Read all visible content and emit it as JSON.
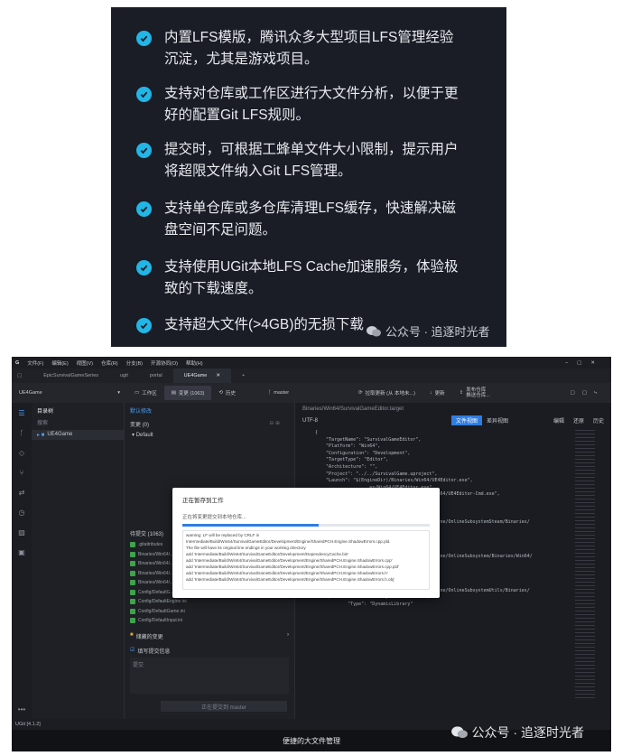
{
  "features": [
    {
      "line1": "内置LFS模版，腾讯众多大型项目LFS管理经验",
      "line2": "沉淀，尤其是游戏项目。"
    },
    {
      "line1": "支持对仓库或工作区进行大文件分析，以便于更",
      "line2": "好的配置Git LFS规则。"
    },
    {
      "line1": "提交时，可根据工蜂单文件大小限制，提示用户",
      "line2": "将超限文件纳入Git LFS管理。"
    },
    {
      "line1": "支持单仓库或多仓库清理LFS缓存，快速解决磁",
      "line2": "盘空间不足问题。"
    },
    {
      "line1": "支持使用UGit本地LFS Cache加速服务，体验极",
      "line2": "致的下载速度。"
    },
    {
      "line1": "支持超大文件(>4GB)的无损下载",
      "line2": ""
    }
  ],
  "watermark": "公众号 · 追逐时光者",
  "app": {
    "menu": [
      "文件(F)",
      "编辑(E)",
      "视图(V)",
      "仓库(R)",
      "分支(B)",
      "开源协同(O)",
      "帮助(H)"
    ],
    "tabs": [
      "EpicSurvivalGameSeries",
      "ugit",
      "portal",
      "UE4Game"
    ],
    "repo_name": "UE4Game",
    "toolbar": {
      "workspace": "工作区",
      "changes": "变更 (1063)",
      "history": "历史",
      "branch": "master",
      "sync": "拉取更新 (从 本地未...)",
      "fetch": "更新",
      "publish": "发布仓库\n推送仓库..."
    },
    "sidebar": {
      "title": "目录树",
      "search": "搜索",
      "tree_item": "UE4Game"
    },
    "mid": {
      "title": "默认修改",
      "group": "变更 (0)",
      "default": "Default",
      "staged_title": "待提交 (1063)",
      "files": [
        ".gitattributes",
        "Binaries/Win64/...",
        "Binaries/Win64/...",
        "Binaries/Win64/...",
        "Binaries/Win64/...",
        "Config/DefaultG...",
        "Config/DefaultEngine.ini",
        "Config/DefaultGame.ini",
        "Config/DefaultInput.ini"
      ],
      "stash": "储藏的变更",
      "commit_msg_label": "填写提交信息",
      "commit_placeholder": "提交",
      "commit_button": "正在提交到 master"
    },
    "right": {
      "path": "Binaries/Win64/SurvivalGameEditor.target",
      "encoding": "UTF-8",
      "view_full": "文件视图",
      "view_diff": "差异视图",
      "actions": [
        "编辑",
        "还原",
        "历史"
      ]
    },
    "code_lines": [
      "{",
      "    \"TargetName\": \"SurvivalGameEditor\",",
      "    \"Platform\": \"Win64\",",
      "    \"Configuration\": \"Development\",",
      "    \"TargetType\": \"Editor\",",
      "    \"Architecture\": \"\",",
      "    \"Project\": \"../../SurvivalGame.uproject\",",
      "    \"Launch\": \"$(EngineDir)/Binaries/Win64/UE4Editor.exe\",",
      "",
      "",
      "",
      "",
      "",
      "",
      "",
      "                 ...es/Win64/UE4Editor.exe\",",
      "",
      "",
      "",
      "",
      "            \"Path\": \"$(EngineDir)/Binaries/Win64/UE4Editor-Cmd.exe\",",
      "            \"Type\": \"Executable\"",
      "        },",
      "        {",
      "            \"Path\": \"$(EngineDir)/Plugins/Online/OnlineSubsystemSteam/Binaries/",
      "Win64/UE4Editor-OnlineSubsystemSteam.dll\",",
      "            \"Type\": \"DynamicLibrary\"",
      "        },",
      "        {",
      "            \"Path\": \"$(EngineDir)/Plugins/Online/OnlineSubsystem/Binaries/Win64/",
      "UE4Editor-OnlineSubsystem.dll\",",
      "            \"Type\": \"DynamicLibrary\"",
      "        },",
      "        {",
      "            \"Path\": \"$(EngineDir)/Plugins/Online/OnlineSubsystemUtils/Binaries/",
      "Win64/UE4Editor-OnlineSubsystemUtils.dll\",",
      "            \"Type\": \"DynamicLibrary\""
    ],
    "modal": {
      "title": "正在暂存到工作",
      "subtitle": "正在将变更提交到本地仓库...",
      "progress": 0.55,
      "log": [
        "warning: LF will be replaced by CRLF in",
        "Intermediate/Build/Win64/SurvivalGameEditor/Development/Engine/SharedPCH.Engine.ShadowErrors.cpp.pld.",
        "The file will have its original line endings in your working directory",
        "add 'Intermediate/Build/Win64/SurvivalGameEditor/Development/DependencyCache.bin'",
        "add 'Intermediate/Build/Win64/SurvivalGameEditor/Development/Engine/SharedPCH.Engine.ShadowErrors.cpp'",
        "add 'Intermediate/Build/Win64/SurvivalGameEditor/Development/Engine/SharedPCH.Engine.ShadowErrors.cpp.pld'",
        "add 'Intermediate/Build/Win64/SurvivalGameEditor/Development/Engine/SharedPCH.Engine.ShadowErrors.h'",
        "add 'Intermediate/Build/Win64/SurvivalGameEditor/Development/Engine/SharedPCH.Engine.ShadowErrors.h.obj'"
      ]
    },
    "status": "UGit [4.1.2]",
    "caption": "便捷的大文件管理"
  },
  "colors": {
    "accent": "#21b6e6",
    "panel": "#1a1d26",
    "primary": "#2f7de1"
  }
}
